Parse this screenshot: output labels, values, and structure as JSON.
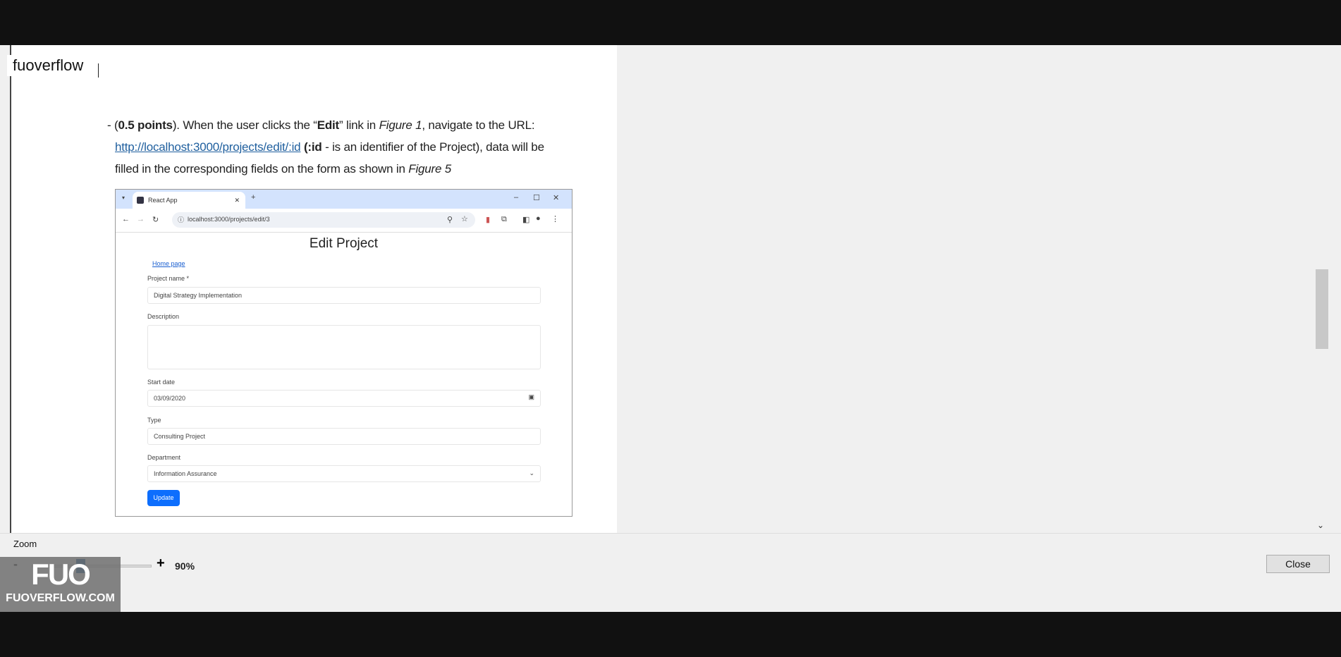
{
  "brand": "fuoverflow",
  "document": {
    "line1": {
      "prefix": "- (",
      "bold": "0.5 points",
      "mid": "). When the user clicks the “",
      "edit": "Edit",
      "mid2": "” link in ",
      "fig": "Figure 1",
      "end": ", navigate to the URL:"
    },
    "line2": {
      "url": "http://localhost:3000/projects/edit/:id",
      "bold": " (:id",
      "rest": " - is an identifier of the Project), data will be"
    },
    "line3": {
      "text": "filled in the corresponding fields on the form as shown in ",
      "fig": "Figure 5"
    }
  },
  "figure": {
    "tab_title": "React App",
    "url": "localhost:3000/projects/edit/3",
    "heading": "Edit Project",
    "home_link": "Home page",
    "fields": {
      "project_name_label": "Project name *",
      "project_name": "Digital Strategy Implementation",
      "description_label": "Description",
      "description": "",
      "start_date_label": "Start date",
      "start_date": "03/09/2020",
      "type_label": "Type",
      "type": "Consulting Project",
      "department_label": "Department",
      "department": "Information Assurance"
    },
    "update_label": "Update"
  },
  "zoom": {
    "label": "Zoom",
    "minus": "-",
    "plus": "+",
    "value": "90%",
    "level_percent": 90
  },
  "close_label": "Close",
  "logo": {
    "mark": "FUO",
    "text": "FUOVERFLOW.COM"
  }
}
